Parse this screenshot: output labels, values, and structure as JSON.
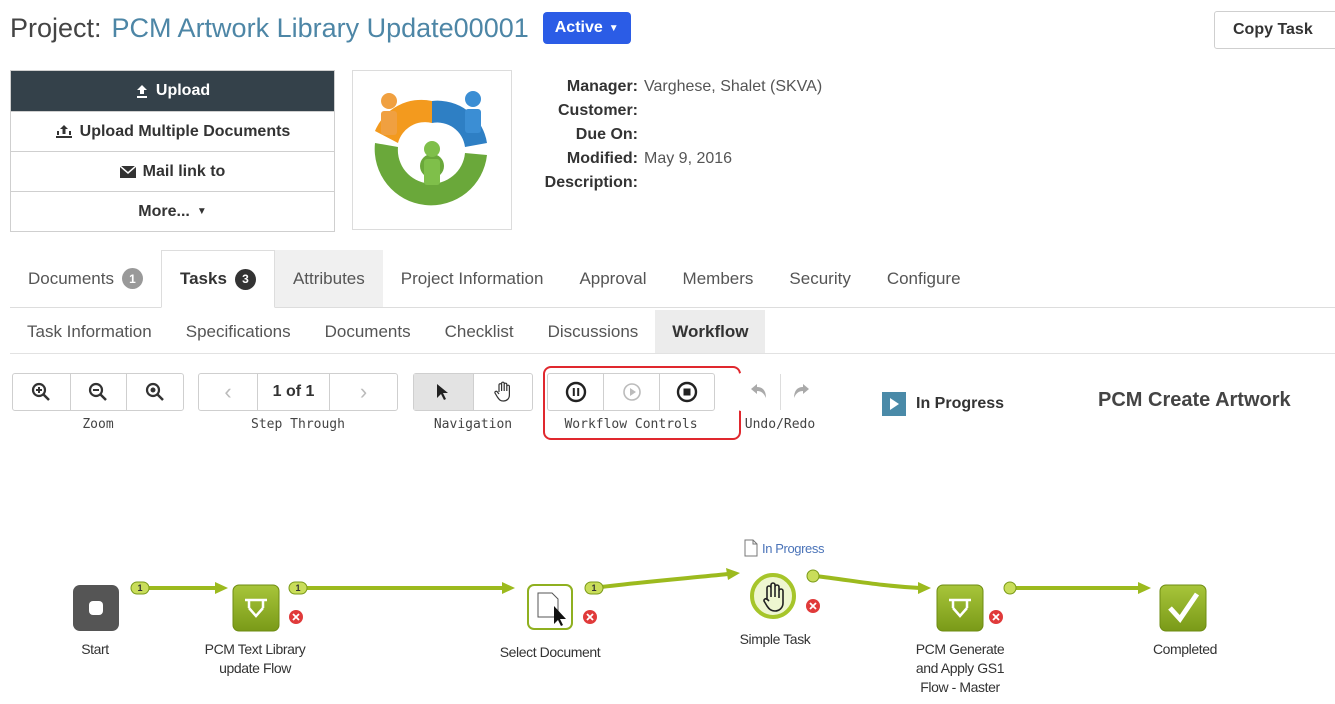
{
  "header": {
    "project_label": "Project:",
    "project_name": "PCM Artwork Library Update00001",
    "status": "Active",
    "copy_task": "Copy Task"
  },
  "actions": [
    {
      "icon": "upload-icon",
      "label": "Upload"
    },
    {
      "icon": "upload-multiple-icon",
      "label": "Upload Multiple Documents"
    },
    {
      "icon": "envelope-icon",
      "label": "Mail link to"
    },
    {
      "icon": "caret-down-icon",
      "label": "More..."
    }
  ],
  "meta": {
    "manager_key": "Manager:",
    "manager": "Varghese, Shalet (SKVA)",
    "customer_key": "Customer:",
    "customer": "",
    "due_key": "Due On:",
    "due": "",
    "modified_key": "Modified:",
    "modified": "May 9, 2016",
    "description_key": "Description:",
    "description": ""
  },
  "tabs": [
    {
      "label": "Documents",
      "count": "1"
    },
    {
      "label": "Tasks",
      "count": "3"
    },
    {
      "label": "Attributes"
    },
    {
      "label": "Project Information"
    },
    {
      "label": "Approval"
    },
    {
      "label": "Members"
    },
    {
      "label": "Security"
    },
    {
      "label": "Configure"
    }
  ],
  "subtabs": [
    "Task Information",
    "Specifications",
    "Documents",
    "Checklist",
    "Discussions",
    "Workflow"
  ],
  "toolbar": {
    "zoom_label": "Zoom",
    "step_label": "Step Through",
    "page": "1 of 1",
    "navigation_label": "Navigation",
    "workflow_controls_label": "Workflow Controls",
    "undo_redo_label": "Undo/Redo",
    "status": "In Progress",
    "task_title": "PCM Create Artwork"
  },
  "workflow": {
    "in_progress_tag": "In Progress",
    "nodes": [
      {
        "name": "start",
        "label": "Start"
      },
      {
        "name": "pcm-text-library",
        "label_1": "PCM Text Library",
        "label_2": "update Flow"
      },
      {
        "name": "select-document",
        "label": "Select Document"
      },
      {
        "name": "simple-task",
        "label": "Simple Task"
      },
      {
        "name": "pcm-generate",
        "label_1": "PCM Generate",
        "label_2": "and Apply GS1",
        "label_3": "Flow - Master"
      },
      {
        "name": "completed",
        "label": "Completed"
      }
    ],
    "connector_badge": "1"
  },
  "colors": {
    "accent": "#2b5ce6",
    "project_name": "#4d86a6",
    "dark_button": "#34414a",
    "highlight": "#e0282e",
    "flow_green": "#9cba1e",
    "error_red": "#e03a3a"
  }
}
